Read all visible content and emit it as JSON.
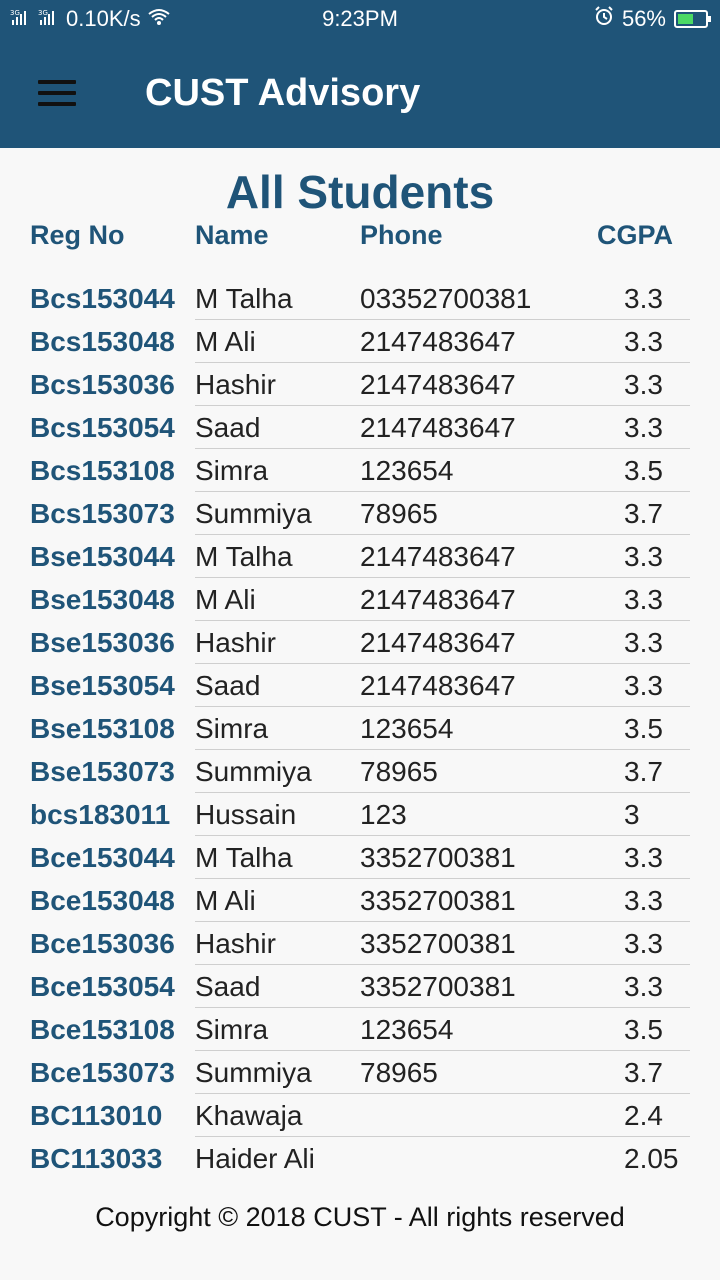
{
  "status": {
    "signal_labels": [
      "3G",
      "3G"
    ],
    "speed": "0.10K/s",
    "time": "9:23PM",
    "battery_pct": "56%",
    "battery_level": 0.56
  },
  "app": {
    "title": "CUST Advisory"
  },
  "page": {
    "title": "All Students"
  },
  "table": {
    "headers": {
      "reg": "Reg No",
      "name": "Name",
      "phone": "Phone",
      "cgpa": "CGPA"
    },
    "rows": [
      {
        "reg": "Bcs153044",
        "name": "M Talha",
        "phone": "03352700381",
        "cgpa": "3.3"
      },
      {
        "reg": "Bcs153048",
        "name": "M Ali",
        "phone": "2147483647",
        "cgpa": "3.3"
      },
      {
        "reg": "Bcs153036",
        "name": "Hashir",
        "phone": "2147483647",
        "cgpa": "3.3"
      },
      {
        "reg": "Bcs153054",
        "name": "Saad",
        "phone": "2147483647",
        "cgpa": "3.3"
      },
      {
        "reg": "Bcs153108",
        "name": "Simra",
        "phone": "123654",
        "cgpa": "3.5"
      },
      {
        "reg": "Bcs153073",
        "name": "Summiya",
        "phone": "78965",
        "cgpa": "3.7"
      },
      {
        "reg": "Bse153044",
        "name": "M Talha",
        "phone": "2147483647",
        "cgpa": "3.3"
      },
      {
        "reg": "Bse153048",
        "name": "M Ali",
        "phone": "2147483647",
        "cgpa": "3.3"
      },
      {
        "reg": "Bse153036",
        "name": "Hashir",
        "phone": "2147483647",
        "cgpa": "3.3"
      },
      {
        "reg": "Bse153054",
        "name": "Saad",
        "phone": "2147483647",
        "cgpa": "3.3"
      },
      {
        "reg": "Bse153108",
        "name": "Simra",
        "phone": "123654",
        "cgpa": "3.5"
      },
      {
        "reg": "Bse153073",
        "name": "Summiya",
        "phone": "78965",
        "cgpa": "3.7"
      },
      {
        "reg": "bcs183011",
        "name": "Hussain",
        "phone": "123",
        "cgpa": "3"
      },
      {
        "reg": "Bce153044",
        "name": "M Talha",
        "phone": "3352700381",
        "cgpa": "3.3"
      },
      {
        "reg": "Bce153048",
        "name": "M Ali",
        "phone": "3352700381",
        "cgpa": "3.3"
      },
      {
        "reg": "Bce153036",
        "name": "Hashir",
        "phone": "3352700381",
        "cgpa": "3.3"
      },
      {
        "reg": "Bce153054",
        "name": "Saad",
        "phone": "3352700381",
        "cgpa": "3.3"
      },
      {
        "reg": "Bce153108",
        "name": "Simra",
        "phone": "123654",
        "cgpa": "3.5"
      },
      {
        "reg": "Bce153073",
        "name": "Summiya",
        "phone": "78965",
        "cgpa": "3.7"
      },
      {
        "reg": "BC113010",
        "name": "Khawaja",
        "phone": "",
        "cgpa": "2.4"
      },
      {
        "reg": "BC113033",
        "name": "Haider Ali",
        "phone": "",
        "cgpa": "2.05"
      }
    ]
  },
  "footer": {
    "text": "Copyright © 2018 CUST - All rights reserved"
  },
  "colors": {
    "primary": "#1f5478",
    "background": "#f8f8f8",
    "battery_fill": "#4cd964"
  },
  "icons": {
    "menu": "hamburger-menu-icon",
    "wifi": "wifi-icon",
    "alarm": "alarm-icon",
    "battery": "battery-charging-icon",
    "signal": "signal-icon"
  }
}
